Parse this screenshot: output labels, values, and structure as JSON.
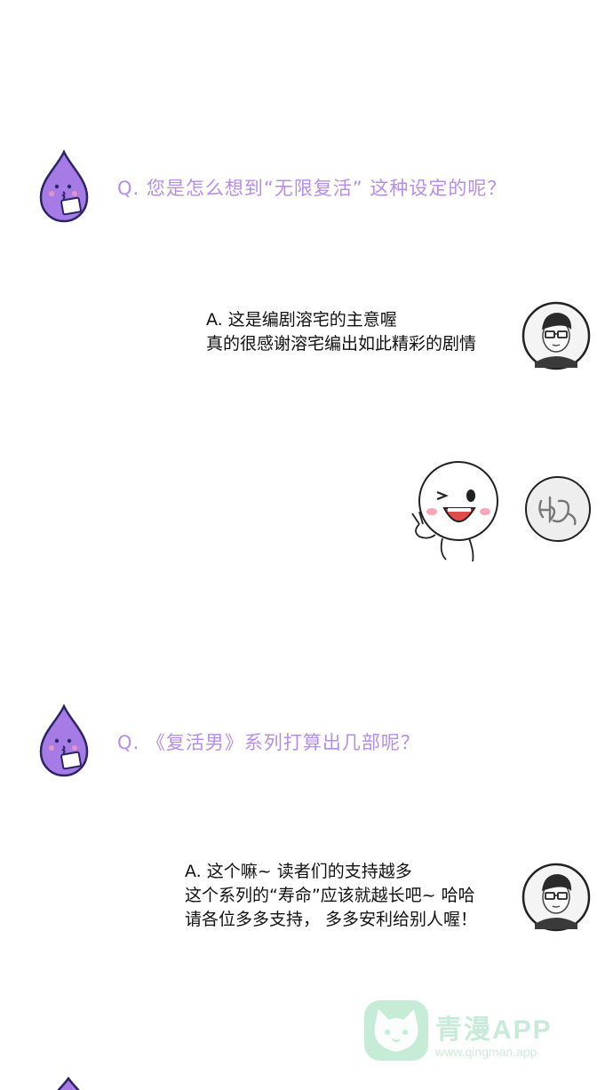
{
  "qa": [
    {
      "question": "Q. 您是怎么想到“无限复活” 这种设定的呢？",
      "answer_lines": [
        "A. 这是编剧溶宅的主意喔",
        "真的很感谢溶宅编出如此精彩的剧情"
      ]
    },
    {
      "question": "Q. 《复活男》系列打算出几部呢？",
      "answer_lines": [
        "A. 这个嘛~ 读者们的支持越多",
        "这个系列的“寿命”应该就越长吧~ 哈哈",
        "请各位多多支持， 多多安利给别人喔！"
      ]
    }
  ],
  "icons": {
    "interviewer": "purple-drop-mascot-icon",
    "author": "author-avatar-icon",
    "reaction": "moon-character-v-sign-icon",
    "signature": "signature-stamp-icon"
  },
  "watermark": {
    "name": "青漫APP",
    "url": "www.qingman.app"
  },
  "colors": {
    "question": "#b58ee8",
    "mascot": "#a77be6",
    "watermark": "#c8ead9"
  }
}
